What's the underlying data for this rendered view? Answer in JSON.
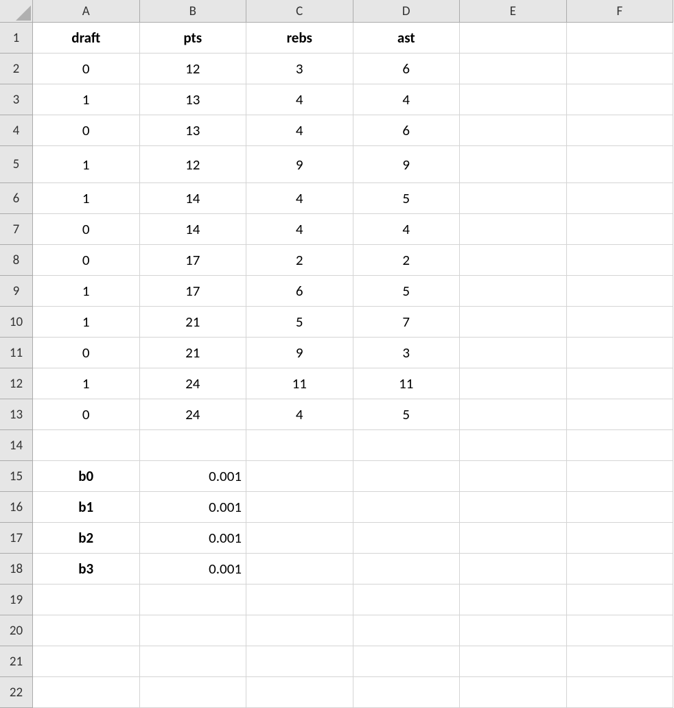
{
  "columns": [
    "A",
    "B",
    "C",
    "D",
    "E",
    "F"
  ],
  "rowNumbers": [
    "1",
    "2",
    "3",
    "4",
    "5",
    "6",
    "7",
    "8",
    "9",
    "10",
    "11",
    "12",
    "13",
    "14",
    "15",
    "16",
    "17",
    "18",
    "19",
    "20",
    "21",
    "22"
  ],
  "tallRowIndex": 4,
  "cells": {
    "r1": {
      "A": "draft",
      "B": "pts",
      "C": "rebs",
      "D": "ast"
    },
    "r2": {
      "A": "0",
      "B": "12",
      "C": "3",
      "D": "6"
    },
    "r3": {
      "A": "1",
      "B": "13",
      "C": "4",
      "D": "4"
    },
    "r4": {
      "A": "0",
      "B": "13",
      "C": "4",
      "D": "6"
    },
    "r5": {
      "A": "1",
      "B": "12",
      "C": "9",
      "D": "9"
    },
    "r6": {
      "A": "1",
      "B": "14",
      "C": "4",
      "D": "5"
    },
    "r7": {
      "A": "0",
      "B": "14",
      "C": "4",
      "D": "4"
    },
    "r8": {
      "A": "0",
      "B": "17",
      "C": "2",
      "D": "2"
    },
    "r9": {
      "A": "1",
      "B": "17",
      "C": "6",
      "D": "5"
    },
    "r10": {
      "A": "1",
      "B": "21",
      "C": "5",
      "D": "7"
    },
    "r11": {
      "A": "0",
      "B": "21",
      "C": "9",
      "D": "3"
    },
    "r12": {
      "A": "1",
      "B": "24",
      "C": "11",
      "D": "11"
    },
    "r13": {
      "A": "0",
      "B": "24",
      "C": "4",
      "D": "5"
    },
    "r15": {
      "A": "b0",
      "B": "0.001"
    },
    "r16": {
      "A": "b1",
      "B": "0.001"
    },
    "r17": {
      "A": "b2",
      "B": "0.001"
    },
    "r18": {
      "A": "b3",
      "B": "0.001"
    }
  },
  "styles": {
    "boldCells": [
      "r1A",
      "r1B",
      "r1C",
      "r1D",
      "r15A",
      "r16A",
      "r17A",
      "r18A"
    ],
    "rightCells": [
      "r15B",
      "r16B",
      "r17B",
      "r18B"
    ]
  }
}
